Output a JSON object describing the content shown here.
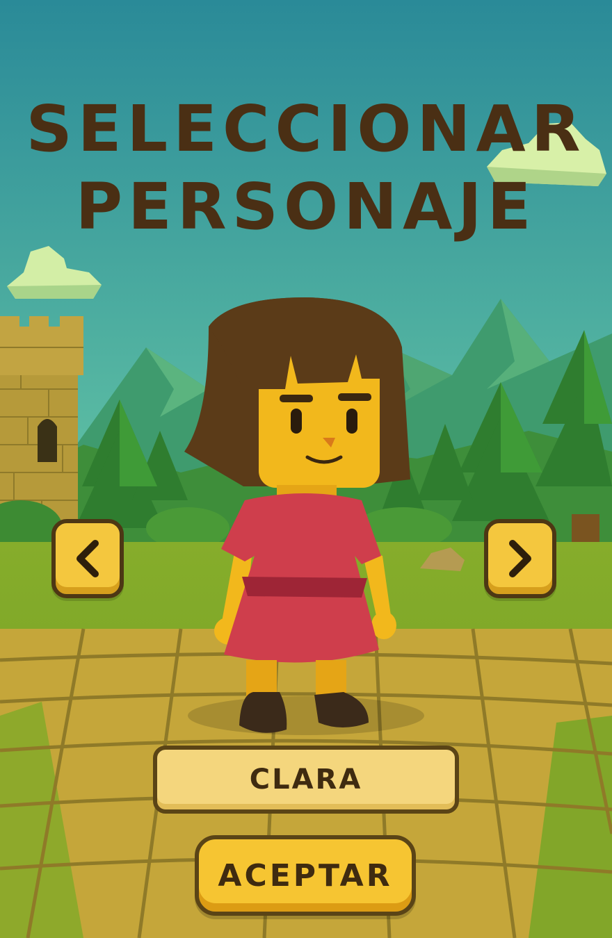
{
  "screen": {
    "title_line1": "SELECCIONAR",
    "title_line2": "PERSONAJE"
  },
  "character": {
    "name": "CLARA"
  },
  "buttons": {
    "accept_label": "ACEPTAR",
    "prev_icon": "chevron-left-icon",
    "next_icon": "chevron-right-icon"
  },
  "colors": {
    "title": "#4a2f14",
    "button": "#f4c73e",
    "button_border": "#4d3714",
    "name_plate": "#f4d67d",
    "sky_top": "#2a8a98",
    "sky_bottom": "#68c9a6",
    "grass": "#8fb22e",
    "path": "#c9a93a",
    "dress": "#cf3e4c",
    "hair": "#5b3b18",
    "skin": "#f2b81c"
  }
}
